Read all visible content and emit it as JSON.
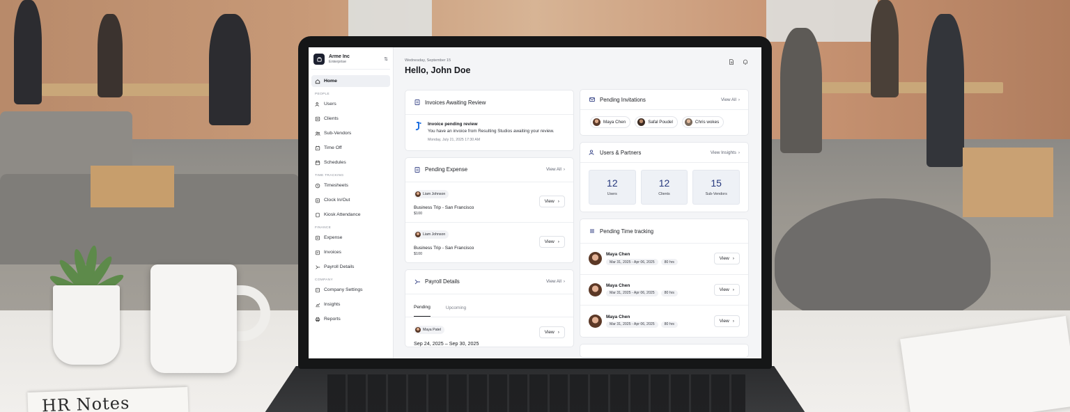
{
  "notebook_text": "HR Notes",
  "app": {
    "org_name": "Arme Inc",
    "org_plan": "Enterprise",
    "date": "Wednesday, September 15",
    "greeting": "Hello, John Doe"
  },
  "sidebar": {
    "home": "Home",
    "sections": {
      "people": "PEOPLE",
      "time": "TIME TRACKING",
      "finance": "FINANCE",
      "company": "COMPANY"
    },
    "people": [
      "Users",
      "Clients",
      "Sub-Vendors",
      "Time Off",
      "Schedules"
    ],
    "time": [
      "Timesheets",
      "Clock In/Out",
      "Kiosk Attendance"
    ],
    "finance": [
      "Expense",
      "Invoices",
      "Payroll Details"
    ],
    "company": [
      "Company Settings",
      "Insights",
      "Reports"
    ]
  },
  "invoices": {
    "title": "Invoices Awaiting Review",
    "item_title": "Invoice pending review",
    "item_desc": "You have an invoice from Resulting Studios awaiting your review.",
    "item_time": "Monday, July 21, 2025   17:30 AM"
  },
  "expense": {
    "title": "Pending Expense",
    "view_all": "View All",
    "rows": [
      {
        "person": "Liam Johnson",
        "name": "Business Trip - San Francisco",
        "amount": "$100",
        "button": "View"
      },
      {
        "person": "Liam Johnson",
        "name": "Business Trip - San Francisco",
        "amount": "$100",
        "button": "View"
      }
    ]
  },
  "payroll": {
    "title": "Payroll Details",
    "view_all": "View All",
    "tabs": [
      "Pending",
      "Upcoming"
    ],
    "person": "Maya Patel",
    "range": "Sep 24, 2025 – Sep 30, 2025",
    "button": "View"
  },
  "invitations": {
    "title": "Pending Invitations",
    "view_all": "View All",
    "people": [
      "Maya Chen",
      "Safal Poudel",
      "Chris wokes"
    ]
  },
  "partners": {
    "title": "Users & Partners",
    "view_insights": "View Insights",
    "stats": [
      {
        "value": "12",
        "label": "Users"
      },
      {
        "value": "12",
        "label": "Clients"
      },
      {
        "value": "15",
        "label": "Sub-Vendors"
      }
    ]
  },
  "time_tracking": {
    "title": "Pending Time tracking",
    "rows": [
      {
        "name": "Maya Chen",
        "range": "Mar 31, 2025 - Apr 06, 2025",
        "hours": "80 hrs",
        "button": "View"
      },
      {
        "name": "Maya Chen",
        "range": "Mar 31, 2025 - Apr 06, 2025",
        "hours": "80 hrs",
        "button": "View"
      },
      {
        "name": "Maya Chen",
        "range": "Mar 31, 2025 - Apr 06, 2025",
        "hours": "80 hrs",
        "button": "View"
      }
    ]
  },
  "colors": {
    "accent_blue": "#26387d",
    "sidebar_active": "#eef0f4",
    "screen_bg": "#f4f5f7"
  }
}
